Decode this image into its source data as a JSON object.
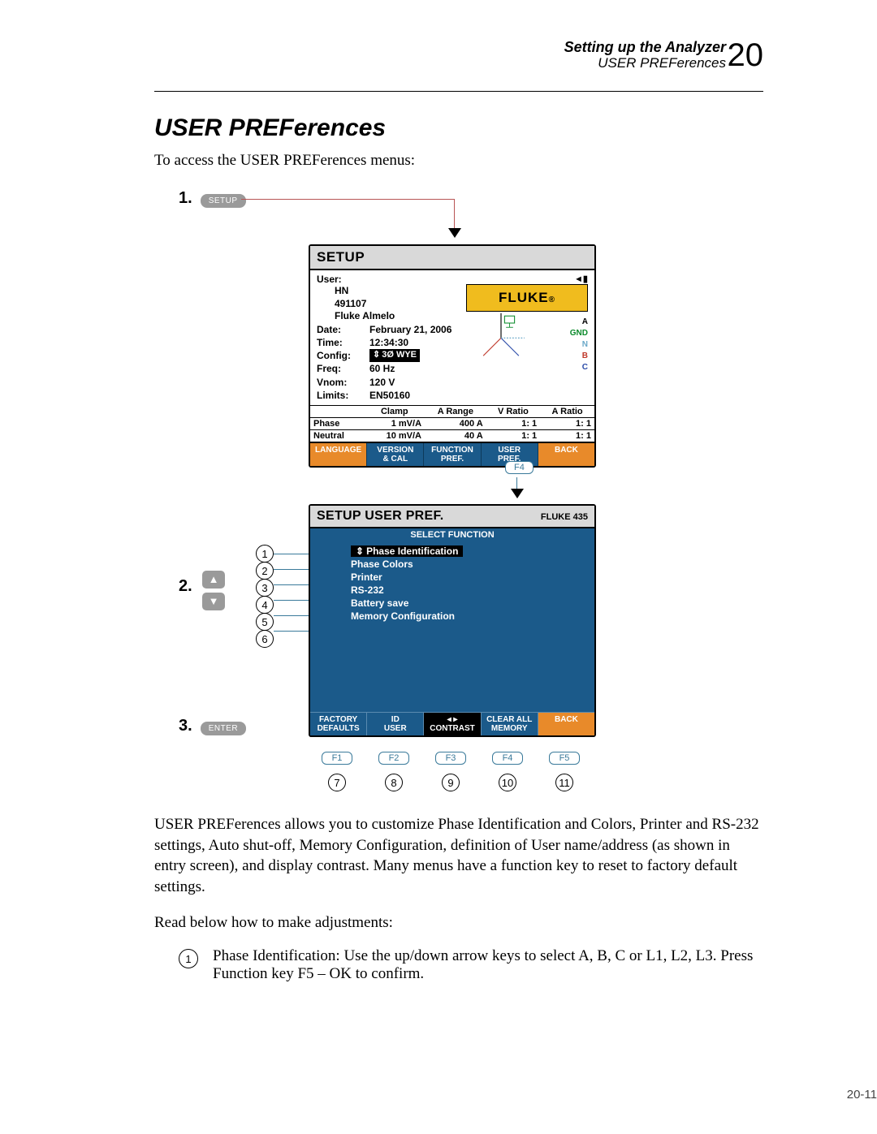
{
  "header": {
    "line1": "Setting up the Analyzer",
    "line2": "USER PREFerences",
    "chapter": "20"
  },
  "title": "USER PREFerences",
  "intro": "To access the USER PREFerences menus:",
  "steps": {
    "s1": "1.",
    "s2": "2.",
    "s3": "3.",
    "setup_btn": "SETUP",
    "enter_btn": "ENTER"
  },
  "scr1": {
    "title": "SETUP",
    "user_label": "User:",
    "user_lines": [
      "HN",
      "491107",
      "Fluke Almelo"
    ],
    "date_k": "Date:",
    "date_v": "February 21, 2006",
    "time_k": "Time:",
    "time_v": "12:34:30",
    "config_k": "Config:",
    "config_v": "3Ø WYE",
    "freq_k": "Freq:",
    "freq_v": "60 Hz",
    "vnom_k": "Vnom:",
    "vnom_v": "120 V",
    "limits_k": "Limits:",
    "limits_v": "EN50160",
    "legend": {
      "a": "A",
      "gnd": "GND",
      "n": "N",
      "b": "B",
      "c": "C"
    },
    "logo": "FLUKE",
    "table": {
      "headers": [
        "",
        "Clamp",
        "A Range",
        "V Ratio",
        "A Ratio"
      ],
      "rows": [
        [
          "Phase",
          "1 mV/A",
          "400 A",
          "1:    1",
          "1:    1"
        ],
        [
          "Neutral",
          "10 mV/A",
          "40 A",
          "1:    1",
          "1:    1"
        ]
      ]
    },
    "softkeys": [
      "LANGUAGE",
      "VERSION\n& CAL",
      "FUNCTION\nPREF.",
      "USER\nPREF.",
      "BACK"
    ]
  },
  "f4_label": "F4",
  "scr2": {
    "title": "SETUP USER PREF.",
    "model": "FLUKE 435",
    "select_bar": "SELECT FUNCTION",
    "items": [
      "Phase Identification",
      "Phase Colors",
      "Printer",
      "RS-232",
      "Battery save",
      "Memory Configuration"
    ],
    "softkeys": [
      "FACTORY\nDEFAULTS",
      "ID\nUSER",
      "◂  ▸\nCONTRAST",
      "CLEAR ALL\nMEMORY",
      "BACK"
    ]
  },
  "fkeys": [
    "F1",
    "F2",
    "F3",
    "F4",
    "F5"
  ],
  "left_circles": [
    "1",
    "2",
    "3",
    "4",
    "5",
    "6"
  ],
  "bottom_circles": [
    "7",
    "8",
    "9",
    "10",
    "11"
  ],
  "para1": "USER PREFerences allows you to customize Phase Identification and Colors, Printer and RS-232 settings, Auto shut-off, Memory Configuration, definition of User name/address (as shown in entry screen), and display contrast. Many menus have a function key to reset to factory default settings.",
  "para2": "Read below how to make adjustments:",
  "def1_num": "1",
  "def1": "Phase Identification: Use the up/down arrow keys to select A, B, C or L1, L2, L3. Press Function key F5 – OK to confirm.",
  "page_num": "20-11"
}
